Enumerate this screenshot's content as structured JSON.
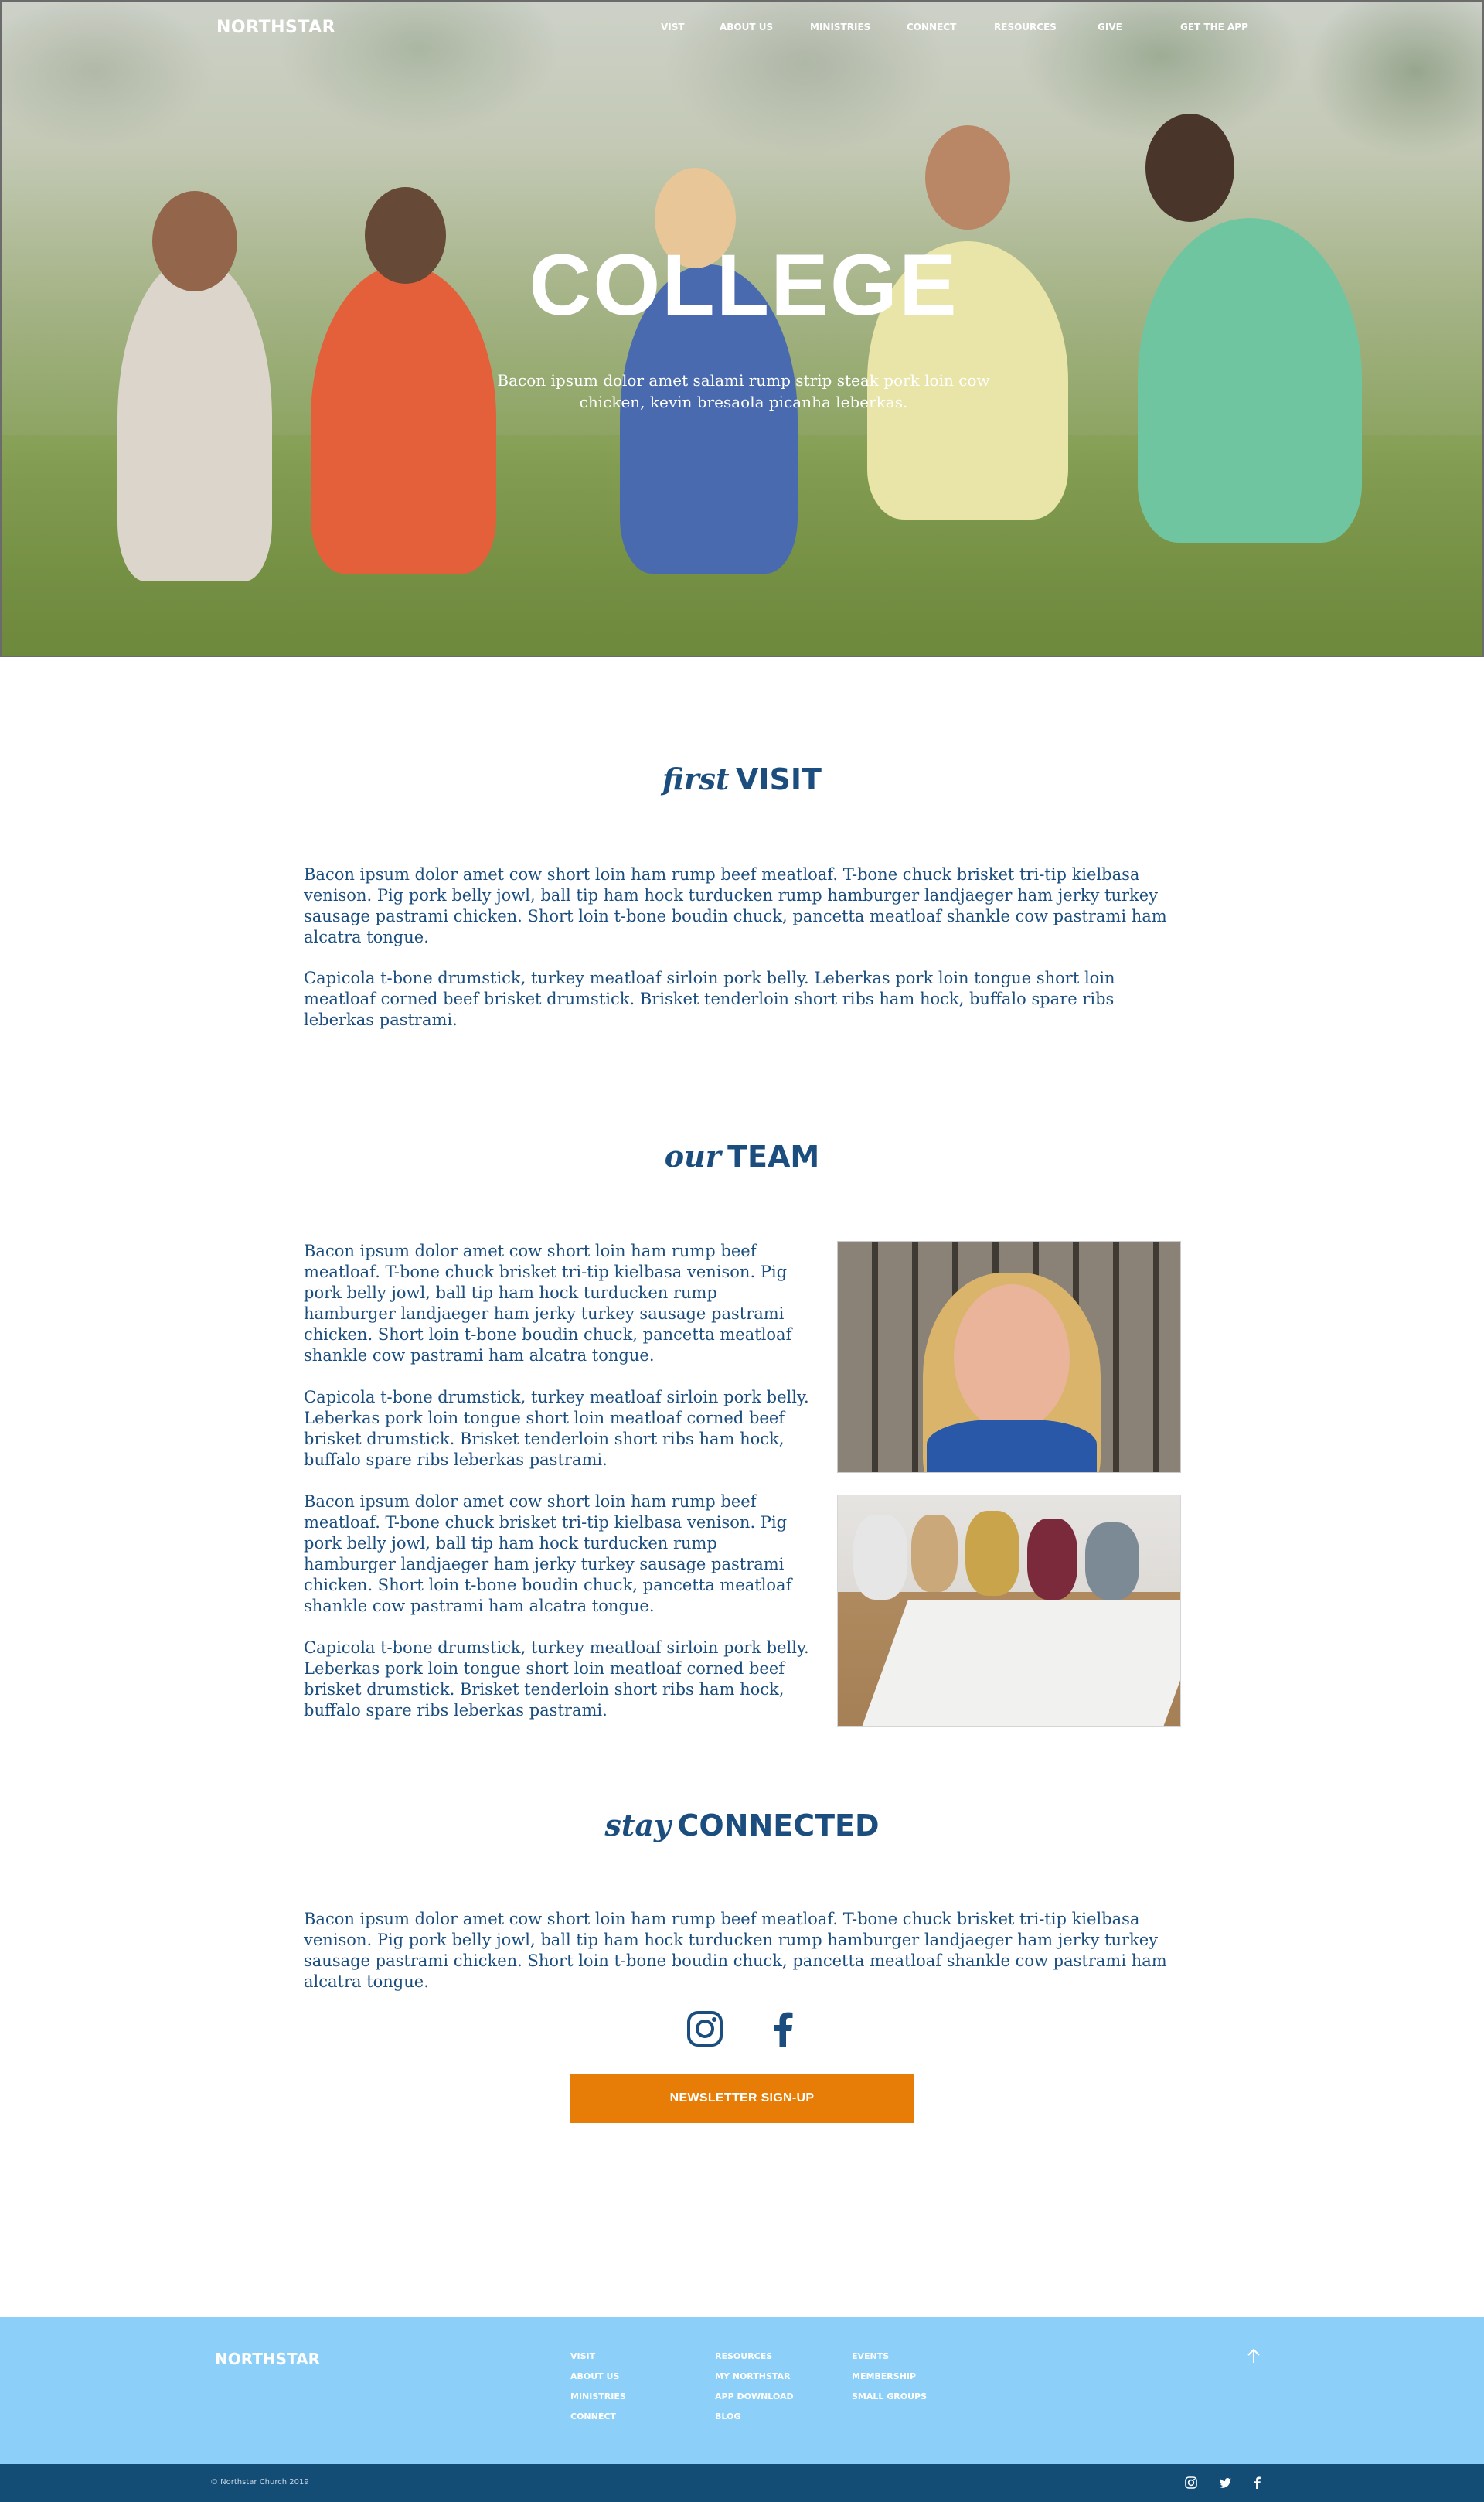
{
  "nav": {
    "brand": "NORTHSTAR",
    "items": [
      "VIST",
      "ABOUT US",
      "MINISTRIES",
      "CONNECT",
      "RESOURCES",
      "GIVE"
    ],
    "cta": "GET THE APP"
  },
  "hero": {
    "title": "COLLEGE",
    "subtitle": "Bacon ipsum dolor amet salami rump strip steak pork loin cow chicken, kevin bresaola picanha leberkas."
  },
  "first_visit": {
    "title_italic": "first",
    "title_bold": "VISIT",
    "p1": "Bacon ipsum dolor amet cow short loin ham rump beef meatloaf. T-bone chuck brisket tri-tip kielbasa venison. Pig pork belly jowl, ball tip ham hock turducken rump hamburger landjaeger ham jerky turkey sausage pastrami chicken. Short loin t-bone boudin chuck, pancetta meatloaf shankle cow pastrami ham alcatra tongue.",
    "p2": "Capicola t-bone drumstick, turkey meatloaf sirloin pork belly. Leberkas pork loin tongue short loin meatloaf corned beef brisket drumstick. Brisket tenderloin short ribs ham hock, buffalo spare ribs leberkas pastrami."
  },
  "team": {
    "title_italic": "our",
    "title_bold": "TEAM",
    "p1": "Bacon ipsum dolor amet cow short loin ham rump beef meatloaf. T-bone chuck brisket tri-tip kielbasa venison. Pig pork belly jowl, ball tip ham hock turducken rump hamburger landjaeger ham jerky turkey sausage pastrami chicken. Short loin t-bone boudin chuck, pancetta meatloaf shankle cow pastrami ham alcatra tongue.",
    "p2": "Capicola t-bone drumstick, turkey meatloaf sirloin pork belly. Leberkas pork loin tongue short loin meatloaf corned beef brisket drumstick. Brisket tenderloin short ribs ham hock, buffalo spare ribs leberkas pastrami.",
    "p3": "Bacon ipsum dolor amet cow short loin ham rump beef meatloaf. T-bone chuck brisket tri-tip kielbasa venison. Pig pork belly jowl, ball tip ham hock turducken rump hamburger landjaeger ham jerky turkey sausage pastrami chicken. Short loin t-bone boudin chuck, pancetta meatloaf shankle cow pastrami ham alcatra tongue.",
    "p4": "Capicola t-bone drumstick, turkey meatloaf sirloin pork belly. Leberkas pork loin tongue short loin meatloaf corned beef brisket drumstick. Brisket tenderloin short ribs ham hock, buffalo spare ribs leberkas pastrami."
  },
  "connected": {
    "title_italic": "stay",
    "title_bold": "CONNECTED",
    "p1": "Bacon ipsum dolor amet cow short loin ham rump beef meatloaf. T-bone chuck brisket tri-tip kielbasa venison. Pig pork belly jowl, ball tip ham hock turducken rump hamburger landjaeger ham jerky turkey sausage pastrami chicken. Short loin t-bone boudin chuck, pancetta meatloaf shankle cow pastrami ham alcatra tongue.",
    "social_icons": [
      "instagram-icon",
      "facebook-icon"
    ],
    "newsletter_label": "NEWSLETTER SIGN-UP"
  },
  "footer": {
    "brand": "NORTHSTAR",
    "col1": [
      "VISIT",
      "ABOUT US",
      "MINISTRIES",
      "CONNECT"
    ],
    "col2": [
      "RESOURCES",
      "MY NORTHSTAR",
      "APP DOWNLOAD",
      "BLOG"
    ],
    "col3": [
      "EVENTS",
      "MEMBERSHIP",
      "SMALL GROUPS"
    ],
    "copyright": "© Northstar Church 2019",
    "bottom_icons": [
      "instagram-icon",
      "twitter-icon",
      "facebook-icon"
    ]
  },
  "colors": {
    "primary_text": "#1b4e7e",
    "button": "#e77c06",
    "footer_bg": "#8cd0f9",
    "bottom_bar": "#134c75"
  }
}
